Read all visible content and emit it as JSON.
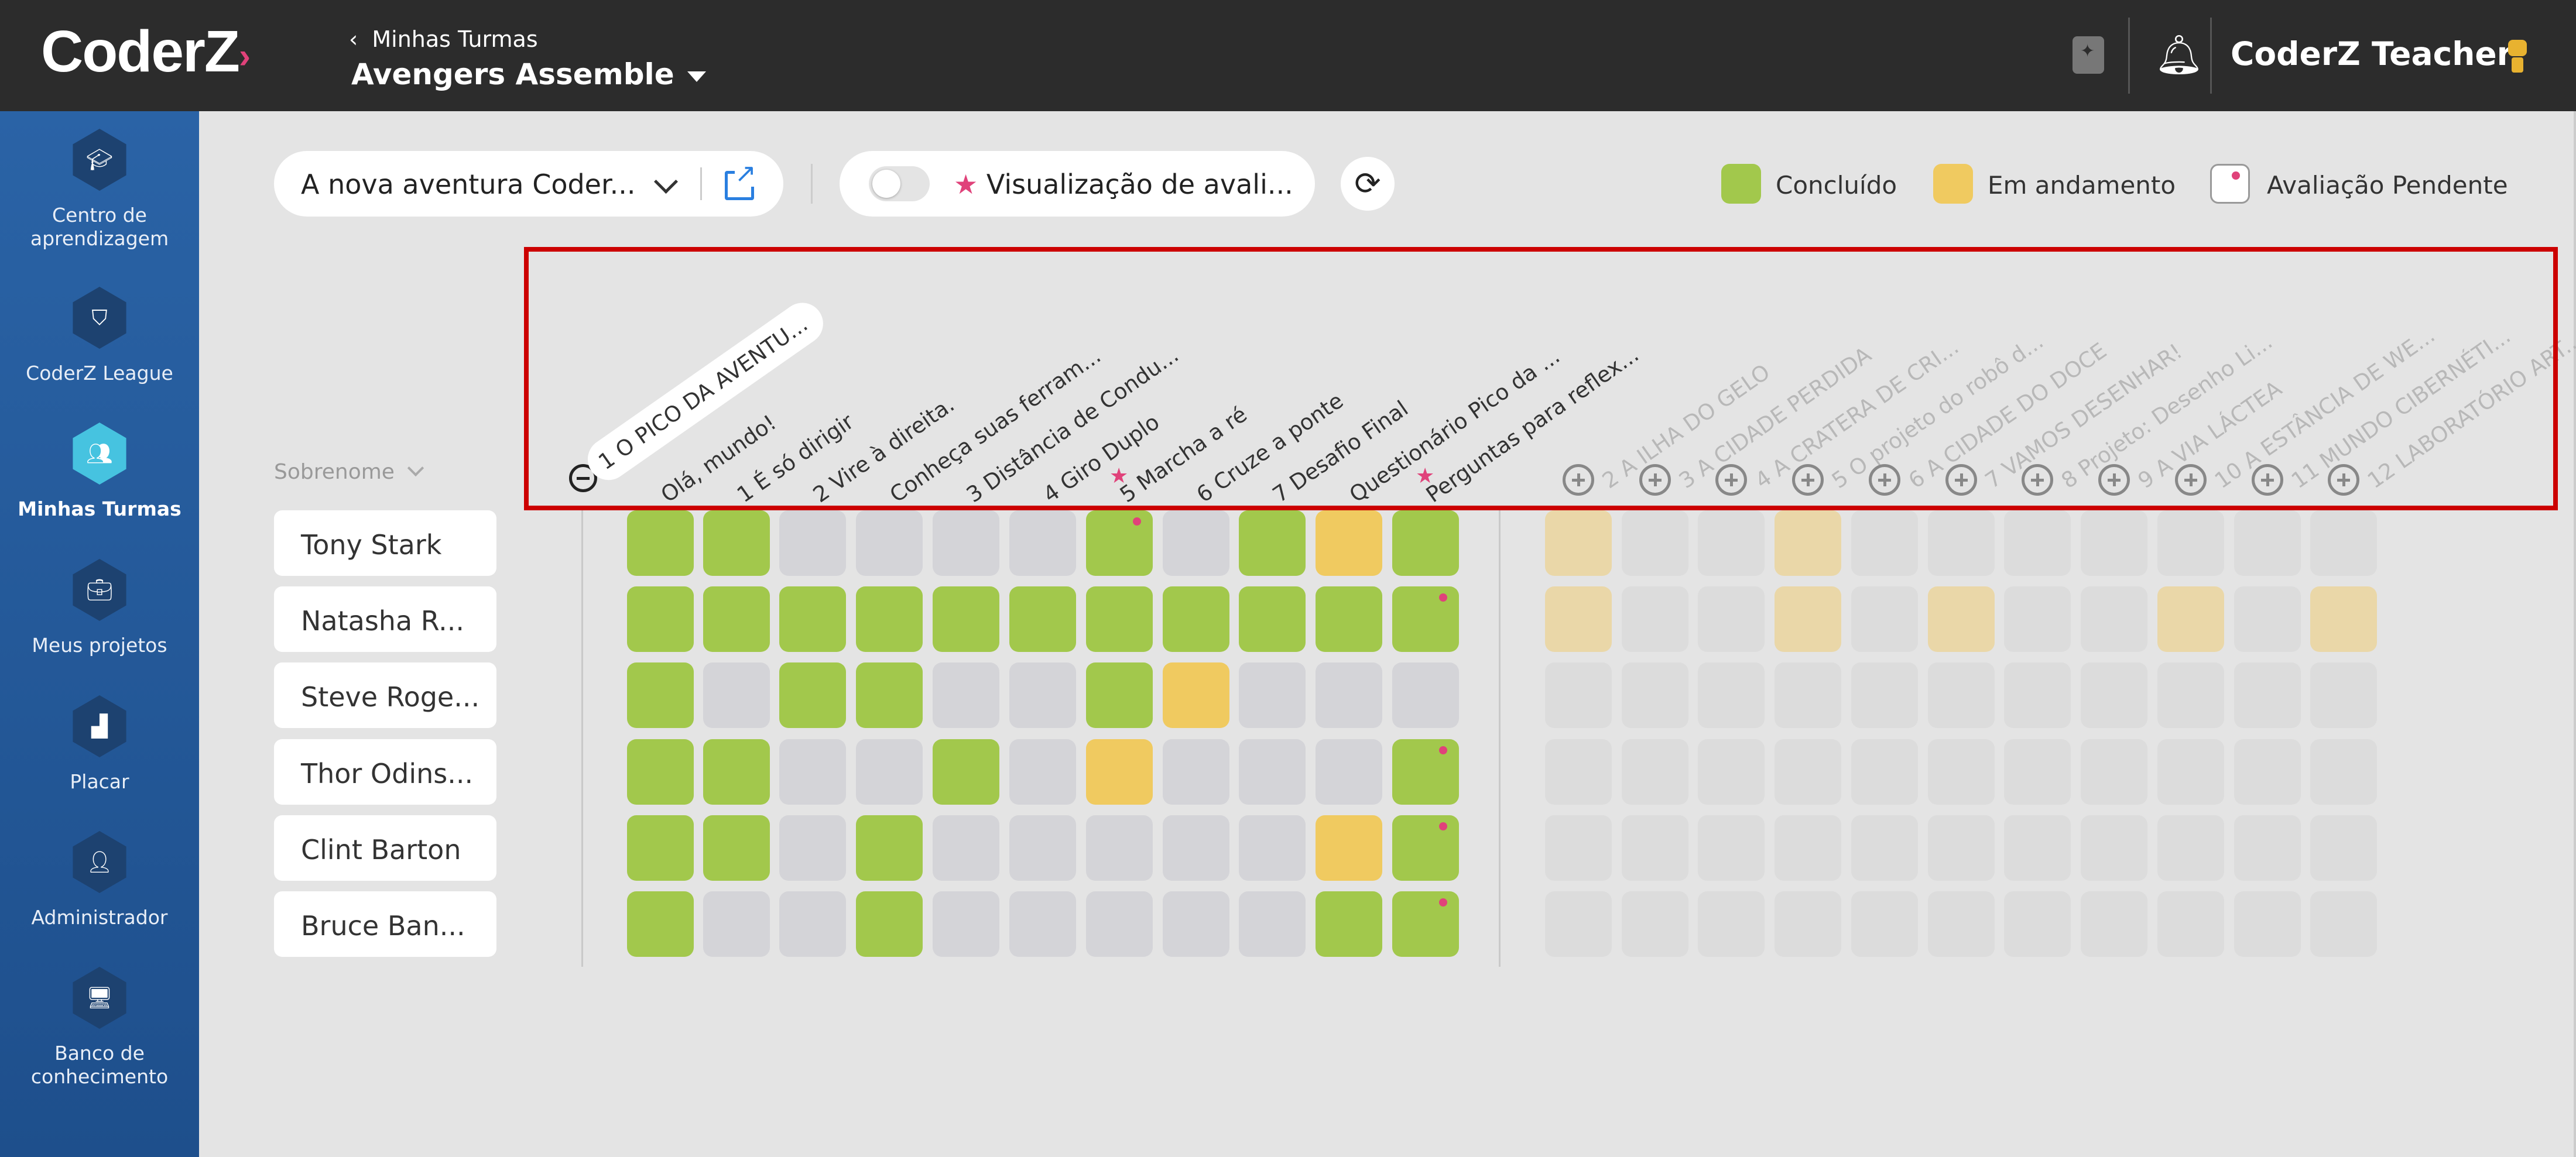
{
  "topbar": {
    "logo": "CoderZ",
    "breadcrumb_back": "Minhas Turmas",
    "class_name": "Avengers Assemble",
    "user_name": "CoderZ Teacher"
  },
  "sidebar": {
    "items": [
      {
        "label": "Centro de aprendizagem",
        "icon": "graduation-cap-icon"
      },
      {
        "label": "CoderZ League",
        "icon": "shield-icon"
      },
      {
        "label": "Minhas Turmas",
        "icon": "group-icon"
      },
      {
        "label": "Meus projetos",
        "icon": "briefcase-icon"
      },
      {
        "label": "Placar",
        "icon": "podium-icon"
      },
      {
        "label": "Administrador",
        "icon": "admin-icon"
      },
      {
        "label": "Banco de conhecimento",
        "icon": "monitor-icon"
      }
    ]
  },
  "toolbar": {
    "course_select": "A nova aventura Coder...",
    "assessment_toggle_label": "Visualização de avali...",
    "legend": {
      "done": "Concluído",
      "in_progress": "Em andamento",
      "pending": "Avaliação Pendente"
    }
  },
  "colors": {
    "done": "#a2c84c",
    "in_progress": "#f0ca60",
    "pending_dot": "#e0427a",
    "sidebar": "#2a63a6"
  },
  "grid": {
    "sort_label": "Sobrenome",
    "group1_title": "1 O PICO DA AVENTU...",
    "columns": [
      {
        "label": "Olá, mundo!"
      },
      {
        "label": "1 É só dirigir"
      },
      {
        "label": "2 Vire à direita."
      },
      {
        "label": "Conheça suas ferram..."
      },
      {
        "label": "3 Distância de Condu..."
      },
      {
        "label": "4 Giro Duplo"
      },
      {
        "label": "5 Marcha a ré",
        "star": true
      },
      {
        "label": "6 Cruze a ponte"
      },
      {
        "label": "7 Desafio Final"
      },
      {
        "label": "Questionário Pico da ..."
      },
      {
        "label": "Perguntas para reflex...",
        "star": true
      }
    ],
    "collapsed_groups": [
      "2 A ILHA DO GELO",
      "3 A CIDADE PERDIDA",
      "4 A CRATERA DE CRI...",
      "5 O projeto do robô d...",
      "6 A CIDADE DO DOCE",
      "7 VAMOS DESENHAR!",
      "8 Projeto: Desenho Li...",
      "9 A VIA LÁCTEA",
      "10 A ESTÂNCIA DE WE...",
      "11 MUNDO CIBERNÉTI...",
      "12 LABORATÓRIO ART..."
    ],
    "students": [
      {
        "name": "Tony Stark",
        "cells": [
          "done",
          "done",
          "none",
          "none",
          "none",
          "none",
          "done-pend",
          "none",
          "done",
          "prog",
          "done"
        ],
        "groups": [
          "prog",
          "none",
          "none",
          "prog",
          "none",
          "none",
          "none",
          "none",
          "none",
          "none",
          "none"
        ]
      },
      {
        "name": "Natasha R...",
        "cells": [
          "done",
          "done",
          "done",
          "done",
          "done",
          "done",
          "done",
          "done",
          "done",
          "done",
          "done-pend"
        ],
        "groups": [
          "prog",
          "none",
          "none",
          "prog",
          "none",
          "prog",
          "none",
          "none",
          "prog",
          "none",
          "prog"
        ]
      },
      {
        "name": "Steve Roge...",
        "cells": [
          "done",
          "none",
          "done",
          "done",
          "none",
          "none",
          "done",
          "prog",
          "none",
          "none",
          "none"
        ],
        "groups": [
          "none",
          "none",
          "none",
          "none",
          "none",
          "none",
          "none",
          "none",
          "none",
          "none",
          "none"
        ]
      },
      {
        "name": "Thor Odins...",
        "cells": [
          "done",
          "done",
          "none",
          "none",
          "done",
          "none",
          "prog",
          "none",
          "none",
          "none",
          "done-pend"
        ],
        "groups": [
          "none",
          "none",
          "none",
          "none",
          "none",
          "none",
          "none",
          "none",
          "none",
          "none",
          "none"
        ]
      },
      {
        "name": "Clint Barton",
        "cells": [
          "done",
          "done",
          "none",
          "done",
          "none",
          "none",
          "none",
          "none",
          "none",
          "prog",
          "done-pend"
        ],
        "groups": [
          "none",
          "none",
          "none",
          "none",
          "none",
          "none",
          "none",
          "none",
          "none",
          "none",
          "none"
        ]
      },
      {
        "name": "Bruce Ban...",
        "cells": [
          "done",
          "none",
          "none",
          "done",
          "none",
          "none",
          "none",
          "none",
          "none",
          "done",
          "done-pend"
        ],
        "groups": [
          "none",
          "none",
          "none",
          "none",
          "none",
          "none",
          "none",
          "none",
          "none",
          "none",
          "none"
        ]
      }
    ]
  }
}
